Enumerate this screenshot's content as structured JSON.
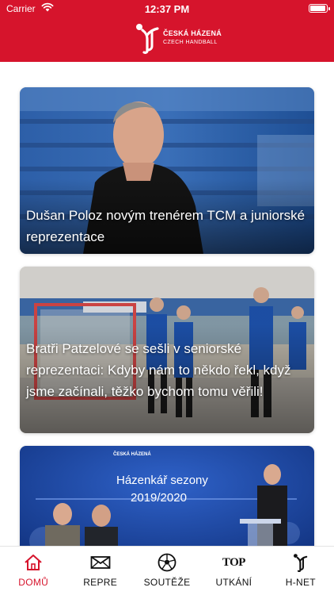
{
  "status_bar": {
    "carrier": "Carrier",
    "time": "12:37 PM"
  },
  "brand": {
    "line1": "ČESKÁ HÁZENÁ",
    "line2": "CZECH HANDBALL",
    "color": "#d6142c"
  },
  "articles": [
    {
      "title": "Dušan Poloz novým trenérem TCM a juniorské reprezentace"
    },
    {
      "title": "Bratři Patzelové se sešli v seniorské reprezentaci: Kdyby nám to někdo řekl, když jsme začínali, těžko bychom tomu věřili!"
    },
    {
      "title": "",
      "image_text_1": "Házenkář sezony",
      "image_text_2": "2019/2020"
    }
  ],
  "tabs": [
    {
      "label": "DOMŮ",
      "icon": "home-icon",
      "active": true
    },
    {
      "label": "REPRE",
      "icon": "envelope-icon",
      "active": false
    },
    {
      "label": "SOUTĚŽE",
      "icon": "ball-icon",
      "active": false
    },
    {
      "label": "UTKÁNÍ",
      "icon": "top-icon",
      "glyph": "TOP",
      "active": false
    },
    {
      "label": "H-NET",
      "icon": "handball-logo-icon",
      "active": false
    }
  ],
  "colors": {
    "accent": "#d6142c",
    "tab_inactive": "#111111"
  }
}
